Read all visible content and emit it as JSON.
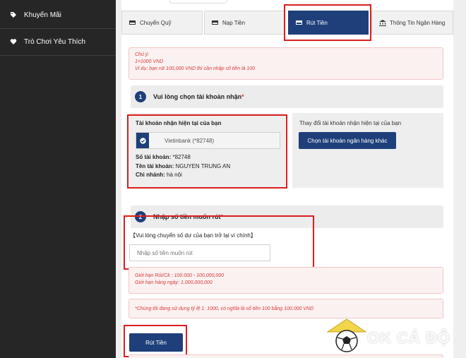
{
  "sidebar": {
    "items": [
      {
        "label": "Khuyến Mãi",
        "icon": "tag-icon"
      },
      {
        "label": "Trò Chơi Yêu Thích",
        "icon": "heart-icon"
      }
    ]
  },
  "tabs": [
    {
      "label": "Chuyển Quỹ",
      "icon": "card-icon"
    },
    {
      "label": "Nạp Tiền",
      "icon": "card-icon"
    },
    {
      "label": "Rút Tiền",
      "icon": "card-icon",
      "active": true
    },
    {
      "label": "Thông Tin Ngân Hàng",
      "icon": "bank-icon"
    }
  ],
  "note": {
    "line1": "Chú ý:",
    "line2": "1=1000 VND",
    "line3": "Ví dụ: bạn rút 100,000 VND thì cần nhập số tiền là 100"
  },
  "step1": {
    "num": "1",
    "title": "Vui lòng chọn tài khoản nhận",
    "required": "*"
  },
  "account": {
    "heading": "Tài khoản nhận hiện tại của bạn",
    "bank_select": "Vietinbank (*82748)",
    "number_label": "Số tài khoản:",
    "number_value": "*82748",
    "name_label": "Tên tài khoản:",
    "name_value": "NGUYEN TRUNG AN",
    "branch_label": "Chi nhánh:",
    "branch_value": "hà nội"
  },
  "change": {
    "heading": "Thay đổi tài khoản nhận hiện tại của bạn",
    "button": "Chọn tài khoản ngân hàng khác"
  },
  "step2": {
    "num": "2",
    "title": "Nhập số tiền muốn rút",
    "required": "*"
  },
  "amount": {
    "hint": "【Vui lòng chuyển số dư của bạn trở lại ví chính】",
    "placeholder": "Nhập số tiền muốn rút"
  },
  "limits": {
    "line1": "Giới hạn Rút/Ck : 100.000 - 100,000,000",
    "line2": "Giới hạn hàng ngày: 1,000,000,000"
  },
  "rate_note": "*Chúng tôi đang sử dụng tỷ lệ 1: 1000, có nghĩa là số tiền 100 bằng 100.000 VND",
  "submit": "Rút Tiền",
  "watermark": "OK CÁ ĐỘ",
  "colors": {
    "accent": "#1e3f7a",
    "alert": "#d63b3b",
    "highlight": "#dc1d1d"
  }
}
